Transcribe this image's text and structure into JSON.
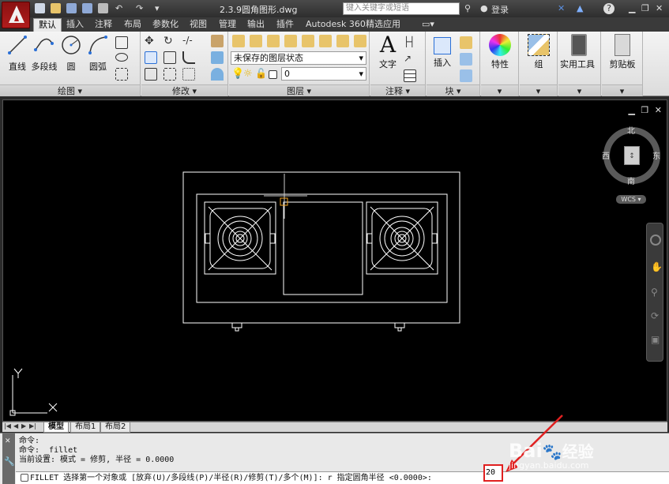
{
  "titlebar": {
    "document_title": "2.3.9圆角图形.dwg",
    "search_placeholder": "键入关键字或短语",
    "login_label": "登录"
  },
  "ribbon_tabs": [
    "默认",
    "插入",
    "注释",
    "布局",
    "参数化",
    "视图",
    "管理",
    "输出",
    "插件",
    "Autodesk 360",
    "精选应用"
  ],
  "ribbon": {
    "draw": {
      "label": "绘图",
      "tools": [
        "直线",
        "多段线",
        "圆",
        "圆弧"
      ]
    },
    "modify": {
      "label": "修改"
    },
    "layers": {
      "label": "图层",
      "layer_state": "未保存的图层状态",
      "current_layer": "0"
    },
    "annotation": {
      "label": "注释",
      "text_tool": "文字"
    },
    "block": {
      "label": "块",
      "insert_tool": "插入"
    },
    "properties_tool": "特性",
    "group_tool": "组",
    "utilities_tool": "实用工具",
    "clipboard_tool": "剪贴板"
  },
  "viewcube": {
    "north": "北",
    "south": "南",
    "east": "东",
    "west": "西",
    "wcs": "WCS"
  },
  "ucs": {
    "y_label": "Y",
    "x_label": "X"
  },
  "layout_tabs": [
    "模型",
    "布局1",
    "布局2"
  ],
  "command": {
    "history": [
      "命令:",
      "命令: _fillet",
      "当前设置: 模式 = 修剪, 半径 = 0.0000"
    ],
    "prompt": "FILLET 选择第一个对象或 [放弃(U)/多段线(P)/半径(R)/修剪(T)/多个(M)]: r 指定圆角半径 <0.0000>:",
    "input_value": "20"
  },
  "watermark": {
    "brand": "Bai",
    "brand2": "经验",
    "url": "jingyan.baidu.com"
  },
  "colors": {
    "accent_red": "#e02020",
    "workspace_bg": "#000000",
    "drawing_line": "#ffffff",
    "cursor_marker": "#f5a623"
  }
}
